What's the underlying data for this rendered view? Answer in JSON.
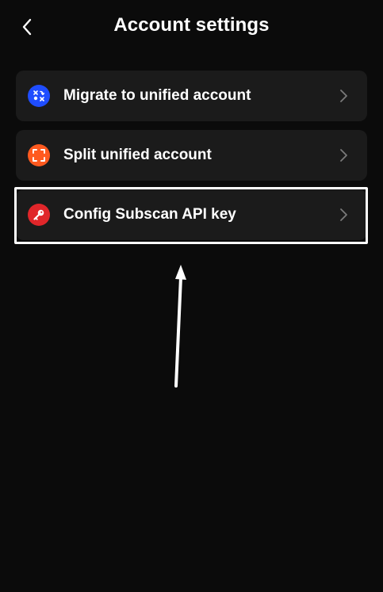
{
  "header": {
    "title": "Account settings",
    "back_icon": "chevron-left-icon"
  },
  "menu": {
    "items": [
      {
        "label": "Migrate to unified account",
        "icon": "migrate-icon",
        "icon_color": "#1f4dff"
      },
      {
        "label": "Split unified account",
        "icon": "split-icon",
        "icon_color": "#ff5a1f"
      },
      {
        "label": "Config Subscan API key",
        "icon": "key-icon",
        "icon_color": "#e0262a"
      }
    ]
  },
  "colors": {
    "background": "#0b0b0b",
    "card": "#1b1b1b",
    "text": "#ffffff",
    "chevron": "#7a7a7a",
    "annotation": "#ffffff"
  }
}
